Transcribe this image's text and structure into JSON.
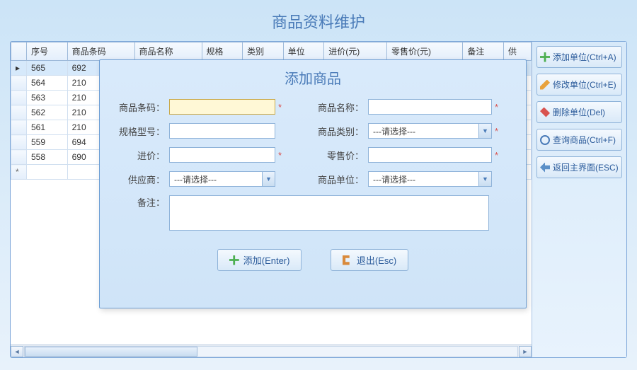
{
  "page_title": "商品资料维护",
  "grid": {
    "columns": [
      "序号",
      "商品条码",
      "商品名称",
      "规格",
      "类别",
      "单位",
      "进价(元)",
      "零售价(元)",
      "备注",
      "供"
    ],
    "rows": [
      {
        "seq": "565",
        "barcode": "692"
      },
      {
        "seq": "564",
        "barcode": "210"
      },
      {
        "seq": "563",
        "barcode": "210"
      },
      {
        "seq": "562",
        "barcode": "210"
      },
      {
        "seq": "561",
        "barcode": "210"
      },
      {
        "seq": "559",
        "barcode": "694"
      },
      {
        "seq": "558",
        "barcode": "690"
      }
    ],
    "new_row_marker": "*"
  },
  "side_buttons": {
    "add": "添加单位(Ctrl+A)",
    "edit": "修改单位(Ctrl+E)",
    "delete": "删除单位(Del)",
    "search": "查询商品(Ctrl+F)",
    "back": "返回主界面(ESC)"
  },
  "dialog": {
    "title": "添加商品",
    "labels": {
      "barcode": "商品条码：",
      "name": "商品名称：",
      "spec": "规格型号：",
      "category": "商品类别：",
      "cost": "进价：",
      "price": "零售价：",
      "supplier": "供应商：",
      "unit": "商品单位：",
      "remark": "备注："
    },
    "placeholder_select": "---请选择---",
    "buttons": {
      "add": "添加(Enter)",
      "exit": "退出(Esc)"
    }
  }
}
